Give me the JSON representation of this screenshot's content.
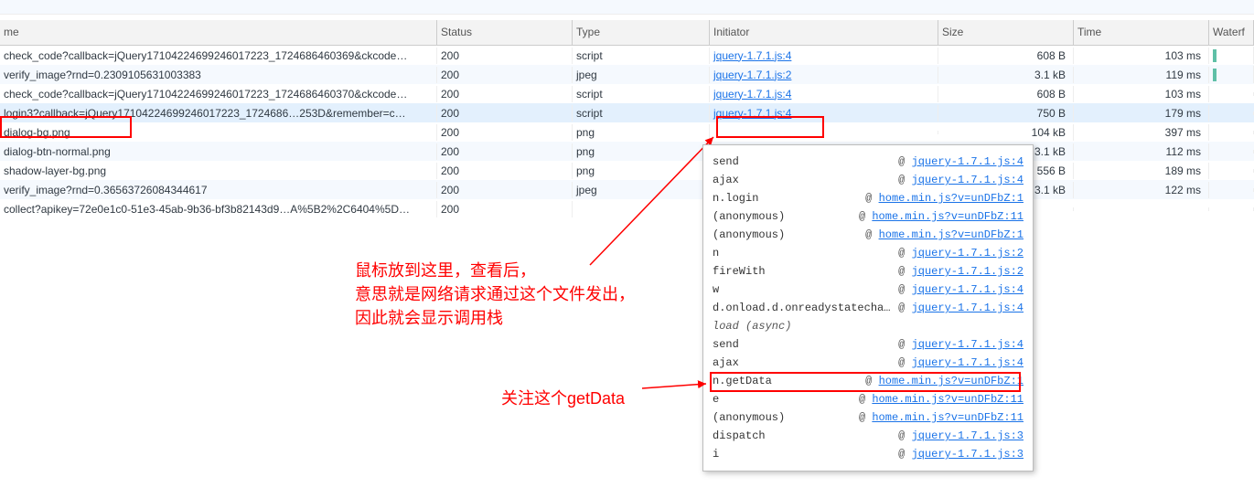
{
  "headers": {
    "name": "me",
    "status": "Status",
    "type": "Type",
    "initiator": "Initiator",
    "size": "Size",
    "time": "Time",
    "waterfall": "Waterf"
  },
  "rows": [
    {
      "name": "check_code?callback=jQuery17104224699246017223_1724686460369&ckcode…",
      "status": "200",
      "type": "script",
      "initiator": "jquery-1.7.1.js:4",
      "size": "608 B",
      "time": "103 ms",
      "wf": true
    },
    {
      "name": "verify_image?rnd=0.2309105631003383",
      "status": "200",
      "type": "jpeg",
      "initiator": "jquery-1.7.1.js:2",
      "size": "3.1 kB",
      "time": "119 ms",
      "wf": true
    },
    {
      "name": "check_code?callback=jQuery17104224699246017223_1724686460370&ckcode…",
      "status": "200",
      "type": "script",
      "initiator": "jquery-1.7.1.js:4",
      "size": "608 B",
      "time": "103 ms",
      "wf": false
    },
    {
      "name": "login3?callback=jQuery17104224699246017223_1724686…253D&remember=c…",
      "status": "200",
      "type": "script",
      "initiator": "jquery-1.7.1.js:4",
      "size": "750 B",
      "time": "179 ms",
      "wf": false,
      "hl": true
    },
    {
      "name": "dialog-bg.png",
      "status": "200",
      "type": "png",
      "initiator": "",
      "size": "104 kB",
      "time": "397 ms",
      "wf": false
    },
    {
      "name": "dialog-btn-normal.png",
      "status": "200",
      "type": "png",
      "initiator": "",
      "size": "3.1 kB",
      "time": "112 ms",
      "wf": false
    },
    {
      "name": "shadow-layer-bg.png",
      "status": "200",
      "type": "png",
      "initiator": "",
      "size": "556 B",
      "time": "189 ms",
      "wf": false
    },
    {
      "name": "verify_image?rnd=0.36563726084344617",
      "status": "200",
      "type": "jpeg",
      "initiator": "",
      "size": "3.1 kB",
      "time": "122 ms",
      "wf": false
    },
    {
      "name": "collect?apikey=72e0e1c0-51e3-45ab-9b36-bf3b82143d9…A%5B2%2C6404%5D…",
      "status": "200",
      "type": "",
      "initiator": "",
      "size": "",
      "time": "",
      "wf": false
    }
  ],
  "tooltip": [
    {
      "fn": "send",
      "src": "jquery-1.7.1.js:4"
    },
    {
      "fn": "ajax",
      "src": "jquery-1.7.1.js:4"
    },
    {
      "fn": "n.login",
      "src": "home.min.js?v=unDFbZ:1"
    },
    {
      "fn": "(anonymous)",
      "src": "home.min.js?v=unDFbZ:11"
    },
    {
      "fn": "(anonymous)",
      "src": "home.min.js?v=unDFbZ:1"
    },
    {
      "fn": "n",
      "src": "jquery-1.7.1.js:2"
    },
    {
      "fn": "fireWith",
      "src": "jquery-1.7.1.js:2"
    },
    {
      "fn": "w",
      "src": "jquery-1.7.1.js:4"
    },
    {
      "fn": "d.onload.d.onreadystatechange",
      "src": "jquery-1.7.1.js:4"
    },
    {
      "fn": "load (async)",
      "italic": true
    },
    {
      "fn": "send",
      "src": "jquery-1.7.1.js:4"
    },
    {
      "fn": "ajax",
      "src": "jquery-1.7.1.js:4"
    },
    {
      "fn": "n.getData",
      "src": "home.min.js?v=unDFbZ:1"
    },
    {
      "fn": "e",
      "src": "home.min.js?v=unDFbZ:11"
    },
    {
      "fn": "(anonymous)",
      "src": "home.min.js?v=unDFbZ:11"
    },
    {
      "fn": "dispatch",
      "src": "jquery-1.7.1.js:3"
    },
    {
      "fn": "i",
      "src": "jquery-1.7.1.js:3"
    }
  ],
  "annotations": {
    "a1_l1": "鼠标放到这里，查看后，",
    "a1_l2": "意思就是网络请求通过这个文件发出，",
    "a1_l3": "因此就会显示调用栈",
    "a2": "关注这个getData"
  },
  "tooltip_at": "@"
}
